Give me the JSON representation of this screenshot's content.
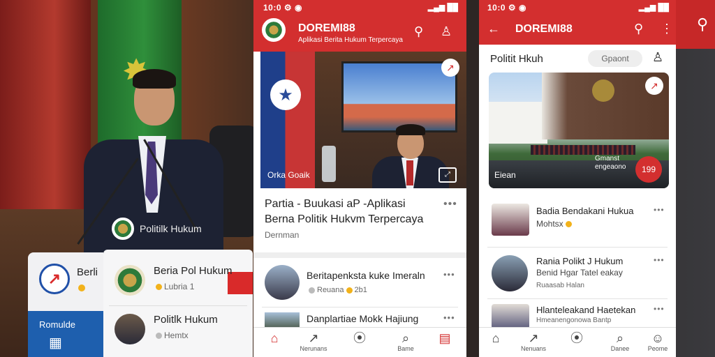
{
  "background": {
    "caption": "Politilk Hukum"
  },
  "left_cards": {
    "card1": {
      "title": "Berli",
      "subtitle": "●",
      "tile_label": "Romulde",
      "logo": "↗"
    },
    "card2": {
      "rows": [
        {
          "title": "Beria Pol Hukum",
          "subtitle": "Lubria 1"
        },
        {
          "title": "Politlk Hukum",
          "subtitle": "Hemtx"
        }
      ]
    }
  },
  "phone1": {
    "status_time": "10:0 ⚙ ◉",
    "status_right": "▂▄▆ ██",
    "app_name": "DOREMI88",
    "app_tagline": "Aplikasi Berita Hukum Terpercaya",
    "hero_caption": "Orka Goaik",
    "headline_line1": "Partia - Buukasi aP -Aplikasi",
    "headline_line2": "Berna Politik Hukvm Terpercaya",
    "headline_meta": "Dernman",
    "articles": [
      {
        "title": "Beritapenksta kuke Imeraln",
        "meta": "Reuana",
        "meta2": "2b1"
      },
      {
        "title": "Danplartiae Mokk Hajiung",
        "meta": "",
        "meta2": ""
      }
    ],
    "nav": [
      {
        "icon": "⌂",
        "label": ""
      },
      {
        "icon": "↗",
        "label": "Nerunans"
      },
      {
        "icon": "⦿",
        "label": ""
      },
      {
        "icon": "⌕",
        "label": "Bame"
      },
      {
        "icon": "▤",
        "label": ""
      }
    ]
  },
  "phone2": {
    "status_time": "10:0 ⚙ ◉",
    "status_right": "▂▄▆ ██",
    "app_name": "DOREMI88",
    "section_title": "Politit Hkuh",
    "search_placeholder": "Gpaont",
    "hero_caption_left": "Eiean",
    "hero_caption_right": "Gmanst\nengeaono",
    "hero_badge": "199",
    "articles": [
      {
        "title": "Badia Bendakani Hukua",
        "sub": "Mohtsx",
        "meta": ""
      },
      {
        "title": "Rania Polikt J Hukum",
        "sub": "Benid Hgar Tatel eakay",
        "meta": "Ruaasab Halan"
      },
      {
        "title": "Hlanteleakand Haetekan",
        "sub": "Hmeanengonowa Bantp",
        "meta": ""
      }
    ],
    "nav": [
      {
        "icon": "⌂",
        "label": ""
      },
      {
        "icon": "↗",
        "label": "Nenuans"
      },
      {
        "icon": "⦿",
        "label": ""
      },
      {
        "icon": "⌕",
        "label": "Danee"
      },
      {
        "icon": "☺",
        "label": "Peome"
      }
    ]
  },
  "colors": {
    "brand": "#d32f2f",
    "accent": "#f2b21b"
  }
}
